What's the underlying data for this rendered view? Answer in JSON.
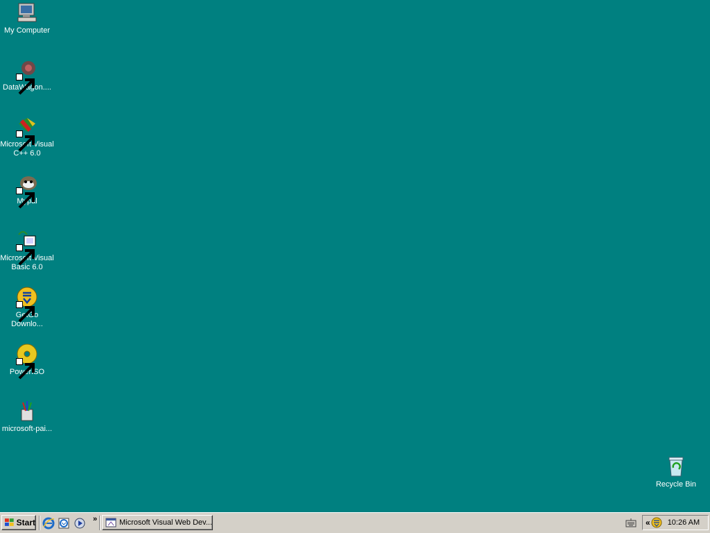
{
  "desktop": {
    "icons": [
      {
        "label": "My Computer"
      },
      {
        "label": "DataWagon...."
      },
      {
        "label": "Microsoft Visual\nC++ 6.0"
      },
      {
        "label": "Mypal"
      },
      {
        "label": "Microsoft Visual\nBasic 6.0"
      },
      {
        "label": "GetGo\nDownlo..."
      },
      {
        "label": "PowerISO"
      },
      {
        "label": "microsoft-pai..."
      }
    ],
    "recycle_bin": {
      "label": "Recycle Bin"
    }
  },
  "taskbar": {
    "start_label": "Start",
    "quick_launch": [
      "internet-explorer-icon",
      "outlook-express-icon",
      "media-player-icon"
    ],
    "task_button_label": "Microsoft Visual Web Dev...",
    "clock": "10:26 AM"
  },
  "colors": {
    "desktop": "#008080",
    "taskbar": "#d4d0c8"
  }
}
